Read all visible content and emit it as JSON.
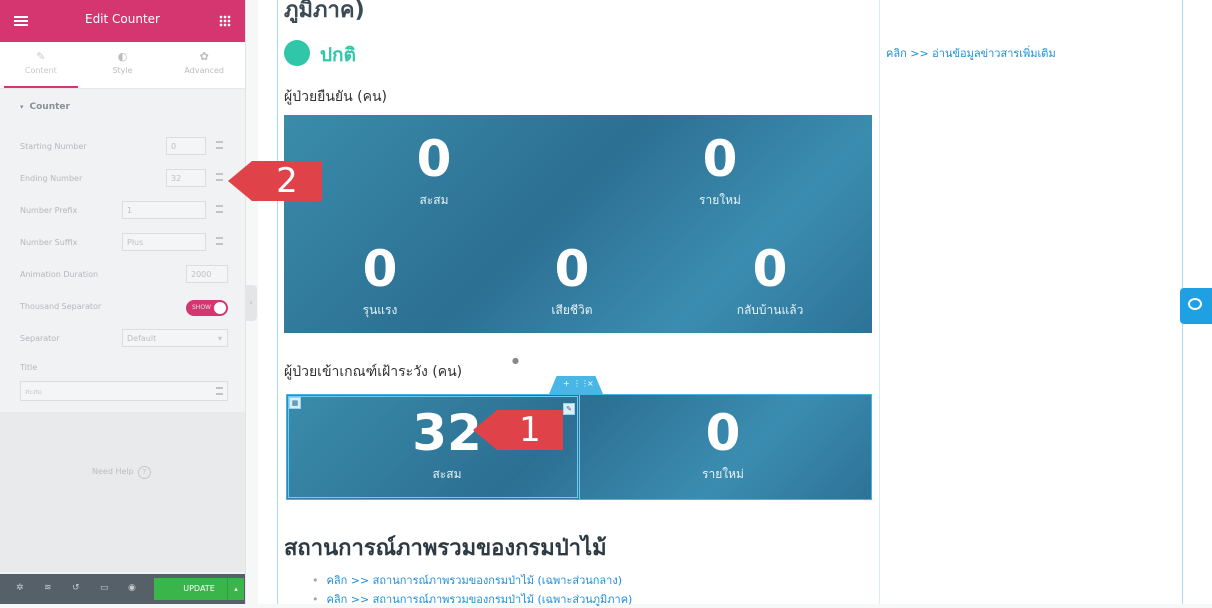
{
  "panel": {
    "title": "Edit Counter",
    "tabs": [
      {
        "label": "Content",
        "icon": "pencil-icon"
      },
      {
        "label": "Style",
        "icon": "contrast-icon"
      },
      {
        "label": "Advanced",
        "icon": "gear-icon"
      }
    ],
    "section_label": "Counter",
    "controls": {
      "starting_number": {
        "label": "Starting Number",
        "value": "0"
      },
      "ending_number": {
        "label": "Ending Number",
        "value": "32"
      },
      "number_prefix": {
        "label": "Number Prefix",
        "value": "1"
      },
      "number_suffix": {
        "label": "Number Suffix",
        "placeholder": "Plus"
      },
      "animation_duration": {
        "label": "Animation Duration",
        "value": "2000"
      },
      "thousand_separator": {
        "label": "Thousand Separator",
        "toggle_text": "SHOW"
      },
      "separator": {
        "label": "Separator",
        "value": "Default"
      },
      "title": {
        "label": "Title",
        "value": "สะสม"
      }
    },
    "help_label": "Need Help",
    "update_label": "UPDATE",
    "accent": "#d5366f"
  },
  "preview": {
    "region_title": "ภูมิภาค)",
    "status_label": "ปกติ",
    "side_link": "คลิก >> อ่านข้อมูลข่าวสารเพิ่มเติม",
    "confirmed_heading": "ผู้ป่วยยืนยัน (คน)",
    "confirmed_stats": [
      {
        "value": "0",
        "caption": "สะสม"
      },
      {
        "value": "0",
        "caption": "รายใหม่"
      },
      {
        "value": "0",
        "caption": "รุนแรง"
      },
      {
        "value": "0",
        "caption": "เสียชีวิต"
      },
      {
        "value": "0",
        "caption": "กลับบ้านแล้ว"
      }
    ],
    "watch_heading": "ผู้ป่วยเข้าเกณฑ์เฝ้าระวัง (คน)",
    "watch_stats": [
      {
        "value": "32",
        "caption": "สะสม"
      },
      {
        "value": "0",
        "caption": "รายใหม่"
      }
    ],
    "overview_title": "สถานการณ์ภาพรวมของกรมป่าไม้",
    "overview_links": [
      "คลิก >> สถานการณ์ภาพรวมของกรมป่าไม้ (เฉพาะส่วนกลาง)",
      "คลิก >> สถานการณ์ภาพรวมของกรมป่าไม้ (เฉพาะส่วนภูมิภาค)"
    ]
  },
  "callouts": {
    "one": "1",
    "two": "2"
  },
  "colors": {
    "status": "#2fc6a9",
    "link": "#1a8fd8",
    "callout": "#e0424a",
    "update": "#39b54a"
  }
}
